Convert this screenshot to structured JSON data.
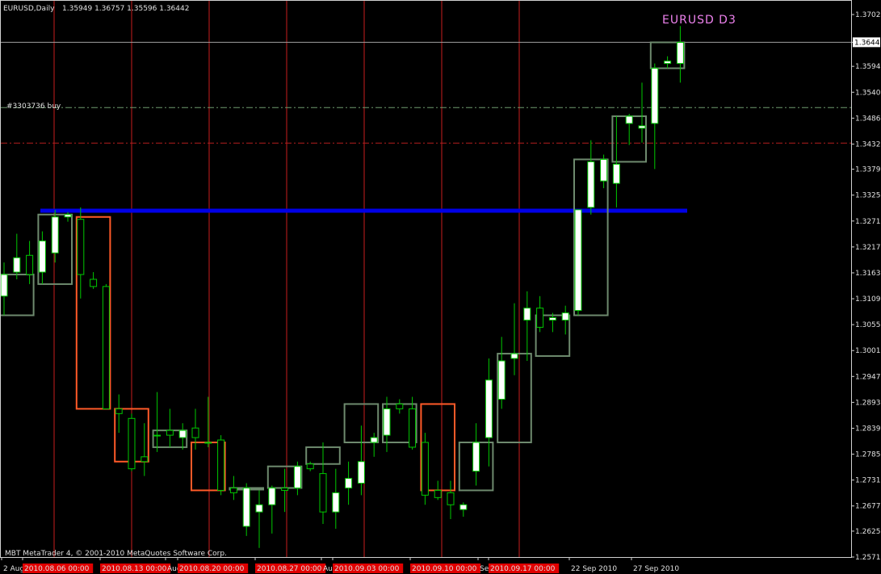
{
  "header": {
    "symbol": "EURUSD,Daily",
    "ohlc": "1.35949 1.36757 1.35596 1.36442"
  },
  "indicator_label": "EURUSD  D3",
  "order_label": "#3303736 buy",
  "copyright": "MBT MetaTrader 4, © 2001-2010 MetaQuotes Software Corp.",
  "colors": {
    "background": "#000000",
    "bull_candle": "#ffffff",
    "bear_candle": "#000000",
    "wick": "#00c800",
    "d3_up": "#6e8a6e",
    "d3_down": "#ff5a28",
    "vline": "#c81e1e",
    "blue_line": "#0000e6",
    "d3_text": "#ee82ee",
    "current_price": "#e0e0e0"
  },
  "chart_data": {
    "type": "candlestick",
    "timeframe": "Daily",
    "ylim": [
      1.2571,
      1.3702
    ],
    "y_ticks": [
      "1.37020",
      "1.36442",
      "1.35940",
      "1.35400",
      "1.34860",
      "1.34320",
      "1.33795",
      "1.33255",
      "1.32715",
      "1.32175",
      "1.31635",
      "1.31095",
      "1.30555",
      "1.30015",
      "1.29475",
      "1.28935",
      "1.28395",
      "1.27855",
      "1.27315",
      "1.26775",
      "1.26250",
      "1.25710"
    ],
    "x_tick_labels": [
      "2 Aug 2010",
      "2010.08.06 00:00",
      "2010.08.13 00:00",
      "Aug",
      "2010.08.20 00:00",
      "2010.08.27 00:00",
      "Aug",
      "2010.09.03 00:00",
      "2010.09.10 00:00",
      "Sep",
      "2010.09.17 00:00",
      "22 Sep 2010",
      "27 Sep 2010"
    ],
    "current_price": 1.36442,
    "horizontal_levels": [
      {
        "name": "blue_level",
        "price": 1.3293
      },
      {
        "name": "order_buy",
        "price": 1.3508
      },
      {
        "name": "stop_level",
        "price": 1.3434
      }
    ],
    "candles": [
      {
        "o": 1.3115,
        "h": 1.3185,
        "l": 1.3075,
        "c": 1.316
      },
      {
        "o": 1.3165,
        "h": 1.3245,
        "l": 1.315,
        "c": 1.3195
      },
      {
        "o": 1.32,
        "h": 1.323,
        "l": 1.314,
        "c": 1.316
      },
      {
        "o": 1.3165,
        "h": 1.325,
        "l": 1.314,
        "c": 1.323
      },
      {
        "o": 1.3205,
        "h": 1.3295,
        "l": 1.3185,
        "c": 1.328
      },
      {
        "o": 1.328,
        "h": 1.329,
        "l": 1.327,
        "c": 1.3285
      },
      {
        "o": 1.3275,
        "h": 1.33,
        "l": 1.311,
        "c": 1.316
      },
      {
        "o": 1.315,
        "h": 1.3165,
        "l": 1.313,
        "c": 1.3135
      },
      {
        "o": 1.3135,
        "h": 1.314,
        "l": 1.288,
        "c": 1.288
      },
      {
        "o": 1.288,
        "h": 1.291,
        "l": 1.283,
        "c": 1.287
      },
      {
        "o": 1.286,
        "h": 1.287,
        "l": 1.275,
        "c": 1.2755
      },
      {
        "o": 1.278,
        "h": 1.285,
        "l": 1.274,
        "c": 1.277
      },
      {
        "o": 1.2825,
        "h": 1.2915,
        "l": 1.279,
        "c": 1.2825
      },
      {
        "o": 1.2835,
        "h": 1.288,
        "l": 1.28,
        "c": 1.2825
      },
      {
        "o": 1.282,
        "h": 1.285,
        "l": 1.2795,
        "c": 1.2835
      },
      {
        "o": 1.284,
        "h": 1.288,
        "l": 1.2795,
        "c": 1.282
      },
      {
        "o": 1.281,
        "h": 1.2905,
        "l": 1.28,
        "c": 1.281
      },
      {
        "o": 1.2815,
        "h": 1.2825,
        "l": 1.27,
        "c": 1.271
      },
      {
        "o": 1.2715,
        "h": 1.274,
        "l": 1.269,
        "c": 1.2705
      },
      {
        "o": 1.2635,
        "h": 1.2725,
        "l": 1.2615,
        "c": 1.2715
      },
      {
        "o": 1.2665,
        "h": 1.271,
        "l": 1.259,
        "c": 1.268
      },
      {
        "o": 1.268,
        "h": 1.272,
        "l": 1.262,
        "c": 1.2715
      },
      {
        "o": 1.2715,
        "h": 1.2755,
        "l": 1.2665,
        "c": 1.271
      },
      {
        "o": 1.2715,
        "h": 1.277,
        "l": 1.27,
        "c": 1.276
      },
      {
        "o": 1.2765,
        "h": 1.277,
        "l": 1.275,
        "c": 1.2755
      },
      {
        "o": 1.2745,
        "h": 1.281,
        "l": 1.264,
        "c": 1.2665
      },
      {
        "o": 1.2665,
        "h": 1.2755,
        "l": 1.263,
        "c": 1.2705
      },
      {
        "o": 1.2715,
        "h": 1.277,
        "l": 1.268,
        "c": 1.2735
      },
      {
        "o": 1.2725,
        "h": 1.2845,
        "l": 1.27,
        "c": 1.277
      },
      {
        "o": 1.281,
        "h": 1.283,
        "l": 1.278,
        "c": 1.282
      },
      {
        "o": 1.2825,
        "h": 1.2905,
        "l": 1.279,
        "c": 1.288
      },
      {
        "o": 1.289,
        "h": 1.29,
        "l": 1.287,
        "c": 1.288
      },
      {
        "o": 1.288,
        "h": 1.2905,
        "l": 1.2795,
        "c": 1.28
      },
      {
        "o": 1.281,
        "h": 1.283,
        "l": 1.268,
        "c": 1.27
      },
      {
        "o": 1.271,
        "h": 1.273,
        "l": 1.269,
        "c": 1.2695
      },
      {
        "o": 1.2705,
        "h": 1.273,
        "l": 1.265,
        "c": 1.268
      },
      {
        "o": 1.267,
        "h": 1.2685,
        "l": 1.2655,
        "c": 1.268
      },
      {
        "o": 1.275,
        "h": 1.285,
        "l": 1.272,
        "c": 1.281
      },
      {
        "o": 1.282,
        "h": 1.2985,
        "l": 1.276,
        "c": 1.294
      },
      {
        "o": 1.29,
        "h": 1.303,
        "l": 1.288,
        "c": 1.298
      },
      {
        "o": 1.2985,
        "h": 1.31,
        "l": 1.295,
        "c": 1.2995
      },
      {
        "o": 1.3065,
        "h": 1.3125,
        "l": 1.298,
        "c": 1.309
      },
      {
        "o": 1.309,
        "h": 1.3115,
        "l": 1.304,
        "c": 1.305
      },
      {
        "o": 1.3065,
        "h": 1.308,
        "l": 1.304,
        "c": 1.307
      },
      {
        "o": 1.3065,
        "h": 1.3095,
        "l": 1.3035,
        "c": 1.308
      },
      {
        "o": 1.3085,
        "h": 1.3295,
        "l": 1.3075,
        "c": 1.3295
      },
      {
        "o": 1.33,
        "h": 1.344,
        "l": 1.3285,
        "c": 1.3395
      },
      {
        "o": 1.3355,
        "h": 1.341,
        "l": 1.334,
        "c": 1.34
      },
      {
        "o": 1.335,
        "h": 1.349,
        "l": 1.33,
        "c": 1.339
      },
      {
        "o": 1.3475,
        "h": 1.3495,
        "l": 1.343,
        "c": 1.349
      },
      {
        "o": 1.3465,
        "h": 1.356,
        "l": 1.3435,
        "c": 1.347
      },
      {
        "o": 1.3475,
        "h": 1.36,
        "l": 1.338,
        "c": 1.359
      },
      {
        "o": 1.36,
        "h": 1.3615,
        "l": 1.359,
        "c": 1.3605
      },
      {
        "o": 1.36,
        "h": 1.3678,
        "l": 1.356,
        "c": 1.3644
      }
    ],
    "d3_boxes": [
      {
        "from": 0,
        "to": 2,
        "o": 1.3115,
        "c": 1.316,
        "h": 1.3245,
        "l": 1.3075,
        "dir": "up"
      },
      {
        "from": 3,
        "to": 5,
        "o": 1.3165,
        "c": 1.3285,
        "h": 1.33,
        "l": 1.314,
        "dir": "up"
      },
      {
        "from": 6,
        "to": 8,
        "o": 1.3275,
        "c": 1.288,
        "h": 1.33,
        "l": 1.288,
        "dir": "down"
      },
      {
        "from": 9,
        "to": 11,
        "o": 1.288,
        "c": 1.277,
        "h": 1.291,
        "l": 1.274,
        "dir": "down"
      },
      {
        "from": 12,
        "to": 14,
        "o": 1.2825,
        "c": 1.2835,
        "h": 1.2915,
        "l": 1.2795,
        "dir": "up"
      },
      {
        "from": 15,
        "to": 17,
        "o": 1.284,
        "c": 1.271,
        "h": 1.2905,
        "l": 1.27,
        "dir": "down"
      },
      {
        "from": 18,
        "to": 20,
        "o": 1.2715,
        "c": 1.2715,
        "h": 1.274,
        "l": 1.259,
        "dir": "up"
      },
      {
        "from": 21,
        "to": 23,
        "o": 1.268,
        "c": 1.276,
        "h": 1.277,
        "l": 1.262,
        "dir": "up"
      },
      {
        "from": 24,
        "to": 26,
        "o": 1.2765,
        "c": 1.2705,
        "h": 1.281,
        "l": 1.263,
        "dir": "up"
      },
      {
        "from": 27,
        "to": 29,
        "o": 1.2715,
        "c": 1.282,
        "h": 1.2845,
        "l": 1.268,
        "dir": "up"
      },
      {
        "from": 30,
        "to": 32,
        "o": 1.2825,
        "c": 1.289,
        "h": 1.2905,
        "l": 1.279,
        "dir": "up"
      },
      {
        "from": 33,
        "to": 35,
        "o": 1.288,
        "c": 1.271,
        "h": 1.2905,
        "l": 1.265,
        "dir": "down"
      },
      {
        "from": 36,
        "to": 38,
        "o": 1.271,
        "c": 1.281,
        "h": 1.285,
        "l": 1.2655,
        "dir": "up"
      },
      {
        "from": 39,
        "to": 41,
        "o": 1.282,
        "c": 1.2995,
        "h": 1.31,
        "l": 1.276,
        "dir": "up"
      },
      {
        "from": 42,
        "to": 44,
        "o": 1.2985,
        "c": 1.308,
        "h": 1.3125,
        "l": 1.298,
        "dir": "up"
      },
      {
        "from": 45,
        "to": 47,
        "o": 1.3065,
        "c": 1.34,
        "h": 1.344,
        "l": 1.3035,
        "dir": "up"
      },
      {
        "from": 48,
        "to": 50,
        "o": 1.33,
        "c": 1.347,
        "h": 1.3495,
        "l": 1.33,
        "dir": "up"
      },
      {
        "from": 51,
        "to": 53,
        "o": 1.3465,
        "c": 1.3644,
        "h": 1.3678,
        "l": 1.338,
        "dir": "up"
      }
    ],
    "d3_box_extents": [
      {
        "from": 0,
        "to": 2,
        "top": 1.316,
        "bottom": 1.3075
      },
      {
        "from": 3,
        "to": 5,
        "top": 1.3285,
        "bottom": 1.314
      },
      {
        "from": 6,
        "to": 8,
        "top": 1.328,
        "bottom": 1.288
      },
      {
        "from": 9,
        "to": 11,
        "top": 1.288,
        "bottom": 1.277
      },
      {
        "from": 12,
        "to": 14,
        "top": 1.2835,
        "bottom": 1.28
      },
      {
        "from": 15,
        "to": 17,
        "top": 1.281,
        "bottom": 1.271
      },
      {
        "from": 18,
        "to": 20,
        "top": 1.2715,
        "bottom": 1.2715
      },
      {
        "from": 21,
        "to": 23,
        "top": 1.276,
        "bottom": 1.2715
      },
      {
        "from": 24,
        "to": 26,
        "top": 1.28,
        "bottom": 1.2765
      },
      {
        "from": 27,
        "to": 29,
        "top": 1.289,
        "bottom": 1.281
      },
      {
        "from": 30,
        "to": 32,
        "top": 1.289,
        "bottom": 1.281
      },
      {
        "from": 33,
        "to": 35,
        "top": 1.289,
        "bottom": 1.271
      },
      {
        "from": 36,
        "to": 38,
        "top": 1.281,
        "bottom": 1.271
      },
      {
        "from": 39,
        "to": 41,
        "top": 1.2995,
        "bottom": 1.281
      },
      {
        "from": 42,
        "to": 44,
        "top": 1.3075,
        "bottom": 1.299
      },
      {
        "from": 45,
        "to": 47,
        "top": 1.34,
        "bottom": 1.3075
      },
      {
        "from": 48,
        "to": 50,
        "top": 1.349,
        "bottom": 1.3395
      },
      {
        "from": 51,
        "to": 53,
        "top": 1.3644,
        "bottom": 1.359
      }
    ]
  }
}
